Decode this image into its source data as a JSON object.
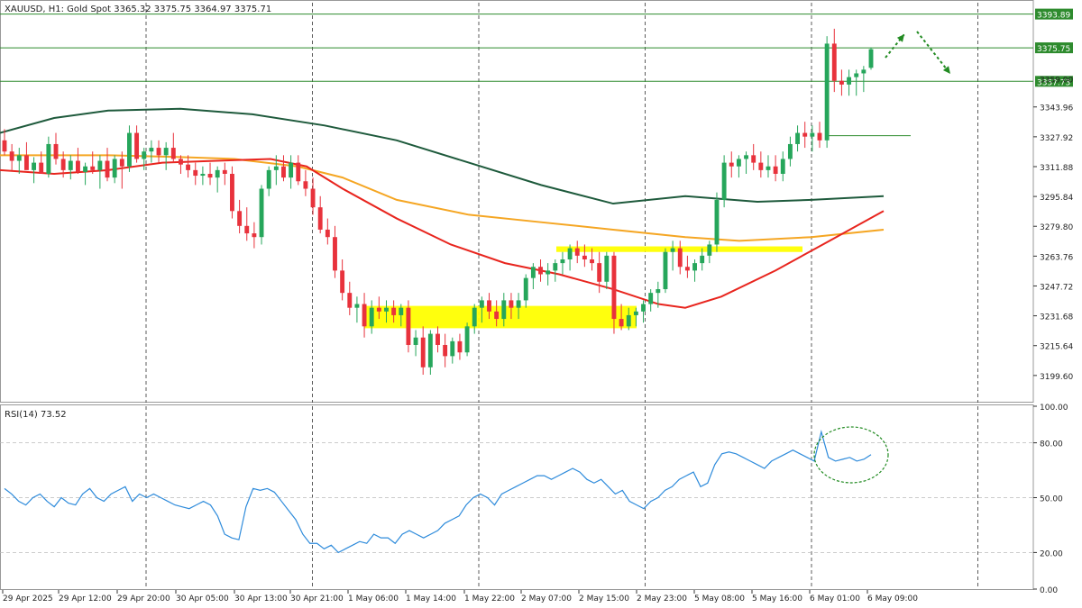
{
  "header": {
    "symbol_line": "XAUUSD, H1:  Gold Spot  3365.32 3375.75 3364.97 3375.71"
  },
  "rsi_panel": {
    "label": "RSI(14) 73.52"
  },
  "colors": {
    "bull": "#26a65b",
    "bear": "#e8323c",
    "ma_short": "#e8251e",
    "ma_mid": "#f5a623",
    "ma_long": "#1e5a3c",
    "support_zone": "#ffff00",
    "rsi_line": "#2e8bdb",
    "hline": "#2e8b2e",
    "arrow": "#228b22"
  },
  "chart_data": [
    {
      "type": "candlestick",
      "symbol": "XAUUSD",
      "timeframe": "H1",
      "price_ticks": [
        3343.96,
        3327.92,
        3311.88,
        3295.84,
        3279.8,
        3263.76,
        3247.72,
        3231.68,
        3215.64,
        3199.6
      ],
      "hidden_tick": "3359.00",
      "ylim": [
        3185,
        3400
      ],
      "time_labels": [
        "29 Apr 2025",
        "29 Apr 12:00",
        "29 Apr 20:00",
        "30 Apr 05:00",
        "30 Apr 13:00",
        "30 Apr 21:00",
        "1 May 06:00",
        "1 May 14:00",
        "1 May 22:00",
        "2 May 07:00",
        "2 May 15:00",
        "2 May 23:00",
        "5 May 08:00",
        "5 May 16:00",
        "6 May 01:00",
        "6 May 09:00"
      ],
      "horizontal_levels": [
        {
          "value": 3393.89,
          "label": "3393.89"
        },
        {
          "value": 3375.75,
          "label": "3375.75"
        },
        {
          "value": 3357.73,
          "label": "3357.73"
        }
      ],
      "minor_level": 3328.5,
      "support_zones": [
        {
          "from_time": "1 May 04:00",
          "to_time": "2 May 18:00",
          "low": 3225,
          "high": 3237
        },
        {
          "from_time": "2 May 08:00",
          "to_time": "5 May 18:00",
          "low": 3266,
          "high": 3269
        }
      ],
      "candles": [
        [
          3326,
          3332,
          3318,
          3320
        ],
        [
          3320,
          3324,
          3310,
          3315
        ],
        [
          3315,
          3322,
          3308,
          3318
        ],
        [
          3318,
          3325,
          3312,
          3310
        ],
        [
          3310,
          3317,
          3303,
          3314
        ],
        [
          3314,
          3320,
          3309,
          3308
        ],
        [
          3308,
          3328,
          3306,
          3324
        ],
        [
          3324,
          3330,
          3313,
          3316
        ],
        [
          3316,
          3320,
          3306,
          3310
        ],
        [
          3310,
          3318,
          3305,
          3315
        ],
        [
          3315,
          3322,
          3308,
          3309
        ],
        [
          3309,
          3314,
          3302,
          3312
        ],
        [
          3312,
          3320,
          3308,
          3310
        ],
        [
          3310,
          3318,
          3300,
          3315
        ],
        [
          3315,
          3322,
          3304,
          3306
        ],
        [
          3306,
          3318,
          3303,
          3316
        ],
        [
          3316,
          3320,
          3300,
          3312
        ],
        [
          3312,
          3334,
          3309,
          3330
        ],
        [
          3330,
          3334,
          3314,
          3316
        ],
        [
          3316,
          3322,
          3310,
          3320
        ],
        [
          3320,
          3326,
          3314,
          3322
        ],
        [
          3322,
          3326,
          3314,
          3318
        ],
        [
          3318,
          3325,
          3310,
          3322
        ],
        [
          3322,
          3330,
          3314,
          3316
        ],
        [
          3316,
          3318,
          3308,
          3313
        ],
        [
          3313,
          3318,
          3306,
          3310
        ],
        [
          3310,
          3314,
          3302,
          3307
        ],
        [
          3307,
          3312,
          3302,
          3308
        ],
        [
          3308,
          3314,
          3302,
          3306
        ],
        [
          3306,
          3312,
          3298,
          3310
        ],
        [
          3310,
          3314,
          3302,
          3308
        ],
        [
          3308,
          3312,
          3284,
          3288
        ],
        [
          3288,
          3294,
          3276,
          3280
        ],
        [
          3280,
          3290,
          3272,
          3276
        ],
        [
          3276,
          3282,
          3268,
          3274
        ],
        [
          3274,
          3302,
          3270,
          3300
        ],
        [
          3300,
          3312,
          3296,
          3310
        ],
        [
          3310,
          3318,
          3302,
          3312
        ],
        [
          3312,
          3318,
          3304,
          3306
        ],
        [
          3306,
          3318,
          3300,
          3314
        ],
        [
          3314,
          3318,
          3302,
          3304
        ],
        [
          3304,
          3310,
          3296,
          3300
        ],
        [
          3300,
          3306,
          3286,
          3290
        ],
        [
          3290,
          3296,
          3276,
          3278
        ],
        [
          3278,
          3284,
          3270,
          3274
        ],
        [
          3274,
          3280,
          3252,
          3256
        ],
        [
          3256,
          3262,
          3240,
          3244
        ],
        [
          3244,
          3250,
          3232,
          3236
        ],
        [
          3236,
          3242,
          3228,
          3238
        ],
        [
          3238,
          3244,
          3220,
          3226
        ],
        [
          3226,
          3240,
          3222,
          3236
        ],
        [
          3236,
          3242,
          3230,
          3234
        ],
        [
          3234,
          3240,
          3228,
          3236
        ],
        [
          3236,
          3240,
          3228,
          3232
        ],
        [
          3232,
          3238,
          3226,
          3236
        ],
        [
          3236,
          3240,
          3212,
          3216
        ],
        [
          3216,
          3224,
          3210,
          3220
        ],
        [
          3220,
          3226,
          3200,
          3204
        ],
        [
          3204,
          3224,
          3200,
          3222
        ],
        [
          3222,
          3226,
          3212,
          3216
        ],
        [
          3216,
          3222,
          3204,
          3210
        ],
        [
          3210,
          3220,
          3206,
          3218
        ],
        [
          3218,
          3222,
          3208,
          3212
        ],
        [
          3212,
          3228,
          3210,
          3226
        ],
        [
          3226,
          3238,
          3222,
          3236
        ],
        [
          3236,
          3242,
          3228,
          3240
        ],
        [
          3240,
          3244,
          3230,
          3234
        ],
        [
          3234,
          3240,
          3226,
          3230
        ],
        [
          3230,
          3244,
          3226,
          3240
        ],
        [
          3240,
          3244,
          3230,
          3236
        ],
        [
          3236,
          3244,
          3230,
          3240
        ],
        [
          3240,
          3254,
          3236,
          3252
        ],
        [
          3252,
          3260,
          3246,
          3258
        ],
        [
          3258,
          3262,
          3250,
          3254
        ],
        [
          3254,
          3260,
          3248,
          3256
        ],
        [
          3256,
          3262,
          3250,
          3260
        ],
        [
          3260,
          3266,
          3254,
          3262
        ],
        [
          3262,
          3270,
          3256,
          3268
        ],
        [
          3268,
          3272,
          3260,
          3264
        ],
        [
          3264,
          3270,
          3258,
          3262
        ],
        [
          3262,
          3268,
          3256,
          3260
        ],
        [
          3260,
          3266,
          3244,
          3250
        ],
        [
          3250,
          3266,
          3246,
          3264
        ],
        [
          3264,
          3266,
          3222,
          3230
        ],
        [
          3230,
          3238,
          3224,
          3226
        ],
        [
          3226,
          3236,
          3224,
          3232
        ],
        [
          3232,
          3236,
          3226,
          3234
        ],
        [
          3234,
          3240,
          3228,
          3238
        ],
        [
          3238,
          3246,
          3234,
          3244
        ],
        [
          3244,
          3250,
          3236,
          3246
        ],
        [
          3246,
          3268,
          3244,
          3266
        ],
        [
          3266,
          3272,
          3256,
          3268
        ],
        [
          3268,
          3272,
          3254,
          3258
        ],
        [
          3258,
          3264,
          3252,
          3256
        ],
        [
          3256,
          3262,
          3250,
          3260
        ],
        [
          3260,
          3268,
          3256,
          3264
        ],
        [
          3264,
          3272,
          3260,
          3270
        ],
        [
          3270,
          3298,
          3266,
          3294
        ],
        [
          3294,
          3318,
          3290,
          3314
        ],
        [
          3314,
          3320,
          3306,
          3312
        ],
        [
          3312,
          3318,
          3306,
          3316
        ],
        [
          3316,
          3320,
          3308,
          3318
        ],
        [
          3318,
          3324,
          3310,
          3314
        ],
        [
          3314,
          3320,
          3306,
          3310
        ],
        [
          3310,
          3318,
          3306,
          3312
        ],
        [
          3312,
          3318,
          3304,
          3308
        ],
        [
          3308,
          3320,
          3304,
          3316
        ],
        [
          3316,
          3328,
          3312,
          3324
        ],
        [
          3324,
          3334,
          3320,
          3330
        ],
        [
          3330,
          3336,
          3322,
          3328
        ],
        [
          3328,
          3334,
          3320,
          3330
        ],
        [
          3330,
          3336,
          3322,
          3326
        ],
        [
          3326,
          3382,
          3322,
          3378
        ],
        [
          3378,
          3386,
          3352,
          3358
        ],
        [
          3358,
          3364,
          3350,
          3356
        ],
        [
          3356,
          3364,
          3350,
          3360
        ],
        [
          3360,
          3364,
          3350,
          3362
        ],
        [
          3362,
          3366,
          3352,
          3364
        ],
        [
          3365,
          3376,
          3364,
          3375
        ]
      ],
      "moving_averages": [
        {
          "role": "long",
          "points": [
            [
              0,
              3330
            ],
            [
              60,
              3338
            ],
            [
              120,
              3342
            ],
            [
              200,
              3343
            ],
            [
              280,
              3340
            ],
            [
              360,
              3334
            ],
            [
              440,
              3326
            ],
            [
              520,
              3314
            ],
            [
              600,
              3302
            ],
            [
              680,
              3292
            ],
            [
              760,
              3296
            ],
            [
              840,
              3293
            ],
            [
              900,
              3294
            ],
            [
              980,
              3296
            ]
          ]
        },
        {
          "role": "mid",
          "points": [
            [
              0,
              3318
            ],
            [
              120,
              3318
            ],
            [
              200,
              3317
            ],
            [
              260,
              3316
            ],
            [
              330,
              3312
            ],
            [
              380,
              3306
            ],
            [
              440,
              3294
            ],
            [
              520,
              3286
            ],
            [
              600,
              3282
            ],
            [
              680,
              3278
            ],
            [
              760,
              3274
            ],
            [
              820,
              3272
            ],
            [
              900,
              3274
            ],
            [
              980,
              3278
            ]
          ]
        },
        {
          "role": "short",
          "points": [
            [
              0,
              3310
            ],
            [
              60,
              3308
            ],
            [
              120,
              3310
            ],
            [
              180,
              3314
            ],
            [
              240,
              3315
            ],
            [
              300,
              3316
            ],
            [
              340,
              3312
            ],
            [
              380,
              3300
            ],
            [
              440,
              3284
            ],
            [
              500,
              3270
            ],
            [
              560,
              3260
            ],
            [
              620,
              3254
            ],
            [
              680,
              3246
            ],
            [
              730,
              3238
            ],
            [
              760,
              3236
            ],
            [
              800,
              3242
            ],
            [
              860,
              3256
            ],
            [
              920,
              3272
            ],
            [
              980,
              3288
            ]
          ]
        }
      ],
      "forecast_arrows": [
        {
          "from_index": 118,
          "direction": "up"
        },
        {
          "from_index": 122,
          "direction": "down"
        }
      ]
    },
    {
      "type": "line",
      "indicator": "RSI(14)",
      "last_value": 73.52,
      "ylim": [
        0,
        100
      ],
      "ticks": [
        100.0,
        80.0,
        50.0,
        20.0,
        0.0
      ],
      "values": [
        55,
        52,
        48,
        46,
        50,
        52,
        48,
        45,
        50,
        47,
        46,
        52,
        55,
        50,
        48,
        52,
        54,
        56,
        48,
        52,
        50,
        52,
        50,
        48,
        46,
        45,
        44,
        46,
        48,
        46,
        40,
        30,
        28,
        27,
        45,
        55,
        54,
        55,
        53,
        48,
        43,
        38,
        30,
        25,
        25,
        22,
        24,
        20,
        22,
        24,
        26,
        25,
        30,
        28,
        28,
        25,
        30,
        32,
        30,
        28,
        30,
        32,
        36,
        38,
        40,
        46,
        50,
        52,
        50,
        46,
        52,
        54,
        56,
        58,
        60,
        62,
        62,
        60,
        62,
        64,
        66,
        64,
        60,
        58,
        60,
        56,
        52,
        54,
        48,
        46,
        44,
        48,
        50,
        54,
        56,
        60,
        62,
        64,
        56,
        58,
        68,
        74,
        75,
        74,
        72,
        70,
        68,
        66,
        70,
        72,
        74,
        76,
        74,
        72,
        70,
        86,
        72,
        70,
        71,
        72,
        70,
        71,
        73.52
      ],
      "highlight_ellipse_on_index": 118
    }
  ]
}
